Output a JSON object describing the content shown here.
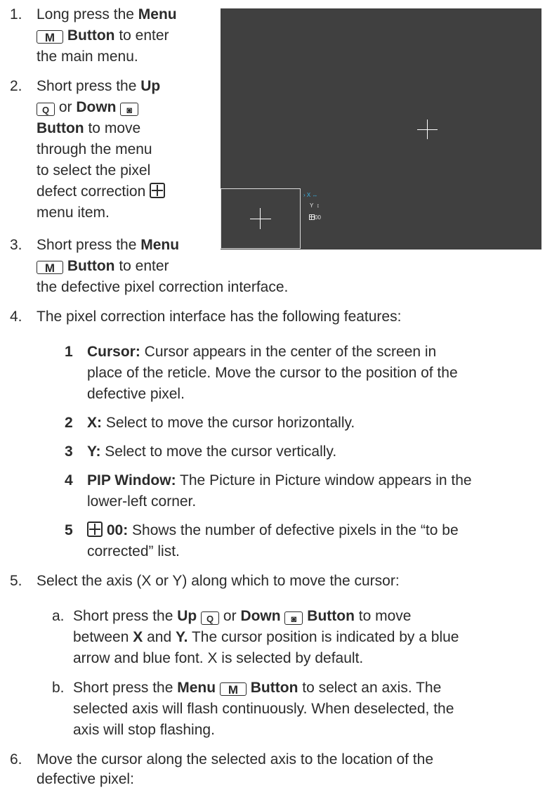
{
  "steps": {
    "s1": {
      "num": "1.",
      "a": "Long press the ",
      "b": "Menu",
      "key": "M",
      "c": " Button",
      "d": " to enter",
      "e": "the main menu."
    },
    "s2": {
      "num": "2.",
      "a": "Short press the ",
      "b": "Up",
      "key_up": "Q",
      "c": " or ",
      "d": "Down",
      "key_down": "◙",
      "e": "Button",
      "f": " to move",
      "g": "through the menu",
      "h": "to select the pixel",
      "i": "defect correction",
      "j": "menu item."
    },
    "s3": {
      "num": "3.",
      "a": "Short press the ",
      "b": "Menu",
      "key": "M",
      "c": " Button",
      "d": " to enter",
      "e": "the defective pixel correction interface."
    },
    "s4": {
      "num": "4.",
      "text": "The pixel correction interface has the following features:"
    },
    "s5": {
      "num": "5.",
      "text": "Select the axis (X or Y) along which to move the cursor:"
    },
    "s6": {
      "num": "6.",
      "line1": "Move the cursor along the selected axis to the location of the",
      "line2": "defective pixel:"
    }
  },
  "features": [
    {
      "n": "1",
      "label": "Cursor:",
      "l1": "  Cursor appears in the center of the screen in",
      "l2": "place of the reticle. Move the cursor to the position of the",
      "l3": "defective pixel."
    },
    {
      "n": "2",
      "label": "X:",
      "l1": "  Select to move the cursor horizontally."
    },
    {
      "n": "3",
      "label": "Y:",
      "l1": "  Select to move the cursor vertically."
    },
    {
      "n": "4",
      "label": "PIP Window:",
      "l1": "  The Picture in Picture window appears in the",
      "l2": "lower-left corner."
    },
    {
      "n": "5",
      "label": "00:",
      "l1": "  Shows the number of defective pixels in the “to be",
      "l2": "corrected” list."
    }
  ],
  "sub": {
    "a": {
      "letter": "a.",
      "p1": "Short press the ",
      "up": "Up",
      "upkey": "Q",
      "or": " or ",
      "down": "Down",
      "downkey": "◙",
      "btn": " Button",
      "p2": " to move",
      "l2a": "between ",
      "x": "X",
      "and": " and ",
      "y": "Y.",
      "l2b": " The cursor position is indicated by a blue",
      "l3": "arrow and blue font. X is selected by default."
    },
    "b": {
      "letter": "b.",
      "p1": "Short press the ",
      "menu": "Menu",
      "key": "M",
      "btn": " Button",
      "p2": " to select an axis. The",
      "l2": "selected axis will flash continuously. When deselected, the",
      "l3": "axis will stop flashing."
    }
  },
  "screen": {
    "menu_x": "X",
    "menu_x_arrow": "↔",
    "menu_y": "Y",
    "menu_y_arrow": "↕",
    "menu_count": "00",
    "selector": "›"
  },
  "colors": {
    "screen_bg": "#404040",
    "accent_blue": "#3ab4e6",
    "text": "#2b2b2b"
  }
}
